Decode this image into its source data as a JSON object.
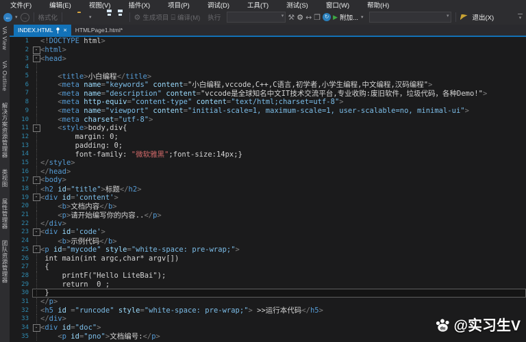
{
  "menu": {
    "items": [
      "文件(F)",
      "编辑(E)",
      "视图(V)",
      "插件(X)",
      "项目(P)",
      "调试(D)",
      "工具(T)",
      "测试(S)",
      "窗口(W)",
      "帮助(H)"
    ]
  },
  "toolbar": {
    "format_label": "格式化",
    "build_label": "生成项目",
    "compile_label": "编译(M)",
    "run_label": "执行",
    "attach_label": "附加...",
    "exit_label": "退出(X)"
  },
  "tabs": [
    {
      "label": "INDEX.HTML",
      "active": true
    },
    {
      "label": "HTMLPage1.html*",
      "active": false
    }
  ],
  "sidebar": {
    "items": [
      "VA View",
      "VA Outline",
      "解决方案资源管理器",
      "类视图",
      "属性管理器",
      "团队资源管理器"
    ]
  },
  "editor": {
    "current_line": 30,
    "lines": [
      {
        "n": 1,
        "fold": false,
        "tokens": [
          [
            "<!",
            "g"
          ],
          [
            "DOCTYPE",
            "t"
          ],
          [
            " html",
            "w"
          ],
          [
            ">",
            "g"
          ]
        ]
      },
      {
        "n": 2,
        "fold": true,
        "tokens": [
          [
            "<",
            "g"
          ],
          [
            "html",
            "t"
          ],
          [
            ">",
            "g"
          ]
        ]
      },
      {
        "n": 3,
        "fold": true,
        "tokens": [
          [
            "<",
            "g"
          ],
          [
            "head",
            "t"
          ],
          [
            ">",
            "g"
          ]
        ]
      },
      {
        "n": 4,
        "fold": false,
        "tokens": []
      },
      {
        "n": 5,
        "fold": false,
        "tokens": [
          [
            "    ",
            "w"
          ],
          [
            "<",
            "g"
          ],
          [
            "title",
            "t"
          ],
          [
            ">",
            "g"
          ],
          [
            "小白编程",
            "w"
          ],
          [
            "</",
            "g"
          ],
          [
            "title",
            "t"
          ],
          [
            ">",
            "g"
          ]
        ]
      },
      {
        "n": 6,
        "fold": false,
        "tokens": [
          [
            "    ",
            "w"
          ],
          [
            "<",
            "g"
          ],
          [
            "meta",
            "t"
          ],
          [
            " ",
            "w"
          ],
          [
            "name",
            "a"
          ],
          [
            "=",
            "g"
          ],
          [
            "\"keywords\"",
            "v"
          ],
          [
            " ",
            "w"
          ],
          [
            "content",
            "a"
          ],
          [
            "=",
            "g"
          ],
          [
            "\"小白编程,vccode,C++,C语言,初学者,小学生编程,中文编程,汉码编程\"",
            "w"
          ],
          [
            ">",
            "g"
          ]
        ]
      },
      {
        "n": 7,
        "fold": false,
        "tokens": [
          [
            "    ",
            "w"
          ],
          [
            "<",
            "g"
          ],
          [
            "meta",
            "t"
          ],
          [
            " ",
            "w"
          ],
          [
            "name",
            "a"
          ],
          [
            "=",
            "g"
          ],
          [
            "\"description\"",
            "v"
          ],
          [
            " ",
            "w"
          ],
          [
            "content",
            "a"
          ],
          [
            "=",
            "g"
          ],
          [
            "\"vccode是全球知名中文IT技术交流平台,专业收购:废旧软件，垃圾代码，各种Demo!\"",
            "w"
          ],
          [
            ">",
            "g"
          ]
        ]
      },
      {
        "n": 8,
        "fold": false,
        "tokens": [
          [
            "    ",
            "w"
          ],
          [
            "<",
            "g"
          ],
          [
            "meta",
            "t"
          ],
          [
            " ",
            "w"
          ],
          [
            "http-equiv",
            "a"
          ],
          [
            "=",
            "g"
          ],
          [
            "\"content-type\"",
            "v"
          ],
          [
            " ",
            "w"
          ],
          [
            "content",
            "a"
          ],
          [
            "=",
            "g"
          ],
          [
            "\"text/html;charset=utf-8\"",
            "v"
          ],
          [
            ">",
            "g"
          ]
        ]
      },
      {
        "n": 9,
        "fold": false,
        "tokens": [
          [
            "    ",
            "w"
          ],
          [
            "<",
            "g"
          ],
          [
            "meta",
            "t"
          ],
          [
            " ",
            "w"
          ],
          [
            "name",
            "a"
          ],
          [
            "=",
            "g"
          ],
          [
            "\"viewport\"",
            "v"
          ],
          [
            " ",
            "w"
          ],
          [
            "content",
            "a"
          ],
          [
            "=",
            "g"
          ],
          [
            "\"initial-scale=1, maximum-scale=1, user-scalable=no, minimal-ui\"",
            "v"
          ],
          [
            ">",
            "g"
          ]
        ]
      },
      {
        "n": 10,
        "fold": false,
        "tokens": [
          [
            "    ",
            "w"
          ],
          [
            "<",
            "g"
          ],
          [
            "meta",
            "t"
          ],
          [
            " ",
            "w"
          ],
          [
            "charset",
            "a"
          ],
          [
            "=",
            "g"
          ],
          [
            "\"utf-8\"",
            "v"
          ],
          [
            ">",
            "g"
          ]
        ]
      },
      {
        "n": 11,
        "fold": true,
        "tokens": [
          [
            "    ",
            "w"
          ],
          [
            "<",
            "g"
          ],
          [
            "style",
            "t"
          ],
          [
            ">",
            "g"
          ],
          [
            "body,div{",
            "w"
          ]
        ]
      },
      {
        "n": 12,
        "fold": false,
        "tokens": [
          [
            "        margin: 0;",
            "w"
          ]
        ]
      },
      {
        "n": 13,
        "fold": false,
        "tokens": [
          [
            "        padding: 0;",
            "w"
          ]
        ]
      },
      {
        "n": 14,
        "fold": false,
        "tokens": [
          [
            "        font-family: ",
            "w"
          ],
          [
            "\"微软雅黑\"",
            "s"
          ],
          [
            ";font-size:14px;}",
            "w"
          ]
        ]
      },
      {
        "n": 15,
        "fold": false,
        "tokens": [
          [
            "</",
            "g"
          ],
          [
            "style",
            "t"
          ],
          [
            ">",
            "g"
          ]
        ]
      },
      {
        "n": 16,
        "fold": false,
        "tokens": [
          [
            "</",
            "g"
          ],
          [
            "head",
            "t"
          ],
          [
            ">",
            "g"
          ]
        ]
      },
      {
        "n": 17,
        "fold": true,
        "tokens": [
          [
            "<",
            "g"
          ],
          [
            "body",
            "t"
          ],
          [
            ">",
            "g"
          ]
        ]
      },
      {
        "n": 18,
        "fold": false,
        "tokens": [
          [
            "<",
            "g"
          ],
          [
            "h2",
            "t"
          ],
          [
            " ",
            "w"
          ],
          [
            "id",
            "a"
          ],
          [
            "=",
            "g"
          ],
          [
            "\"title\"",
            "v"
          ],
          [
            ">",
            "g"
          ],
          [
            "标题",
            "w"
          ],
          [
            "</",
            "g"
          ],
          [
            "h2",
            "t"
          ],
          [
            ">",
            "g"
          ]
        ]
      },
      {
        "n": 19,
        "fold": true,
        "tokens": [
          [
            "<",
            "g"
          ],
          [
            "div",
            "t"
          ],
          [
            " ",
            "w"
          ],
          [
            "id",
            "a"
          ],
          [
            "=",
            "g"
          ],
          [
            "'content'",
            "v"
          ],
          [
            ">",
            "g"
          ]
        ]
      },
      {
        "n": 20,
        "fold": false,
        "tokens": [
          [
            "    ",
            "w"
          ],
          [
            "<",
            "g"
          ],
          [
            "b",
            "t"
          ],
          [
            ">",
            "g"
          ],
          [
            "文档内容",
            "w"
          ],
          [
            "</",
            "g"
          ],
          [
            "b",
            "t"
          ],
          [
            ">",
            "g"
          ]
        ]
      },
      {
        "n": 21,
        "fold": false,
        "tokens": [
          [
            "    ",
            "w"
          ],
          [
            "<",
            "g"
          ],
          [
            "p",
            "t"
          ],
          [
            ">",
            "g"
          ],
          [
            "请开始编写你的内容..",
            "w"
          ],
          [
            "</",
            "g"
          ],
          [
            "p",
            "t"
          ],
          [
            ">",
            "g"
          ]
        ]
      },
      {
        "n": 22,
        "fold": false,
        "tokens": [
          [
            "</",
            "g"
          ],
          [
            "div",
            "t"
          ],
          [
            ">",
            "g"
          ]
        ]
      },
      {
        "n": 23,
        "fold": true,
        "tokens": [
          [
            "<",
            "g"
          ],
          [
            "div",
            "t"
          ],
          [
            " ",
            "w"
          ],
          [
            "id",
            "a"
          ],
          [
            "=",
            "g"
          ],
          [
            "'code'",
            "v"
          ],
          [
            ">",
            "g"
          ]
        ]
      },
      {
        "n": 24,
        "fold": false,
        "tokens": [
          [
            "    ",
            "w"
          ],
          [
            "<",
            "g"
          ],
          [
            "b",
            "t"
          ],
          [
            ">",
            "g"
          ],
          [
            "示例代码",
            "w"
          ],
          [
            "</",
            "g"
          ],
          [
            "b",
            "t"
          ],
          [
            ">",
            "g"
          ]
        ]
      },
      {
        "n": 25,
        "fold": true,
        "tokens": [
          [
            "<",
            "g"
          ],
          [
            "p",
            "t"
          ],
          [
            " ",
            "w"
          ],
          [
            "id",
            "a"
          ],
          [
            "=",
            "g"
          ],
          [
            "\"mycode\"",
            "v"
          ],
          [
            " ",
            "w"
          ],
          [
            "style",
            "a"
          ],
          [
            "=",
            "g"
          ],
          [
            "\"white-space: pre-wrap;\"",
            "v"
          ],
          [
            ">",
            "g"
          ]
        ]
      },
      {
        "n": 26,
        "fold": false,
        "tokens": [
          [
            " int main(int argc,char* argv[])",
            "w"
          ]
        ]
      },
      {
        "n": 27,
        "fold": false,
        "tokens": [
          [
            " {",
            "w"
          ]
        ]
      },
      {
        "n": 28,
        "fold": false,
        "tokens": [
          [
            "     printF(\"Hello LiteBai\");",
            "w"
          ]
        ]
      },
      {
        "n": 29,
        "fold": false,
        "tokens": [
          [
            "     return  0 ;",
            "w"
          ]
        ]
      },
      {
        "n": 30,
        "fold": false,
        "tokens": [
          [
            " }",
            "w"
          ]
        ]
      },
      {
        "n": 31,
        "fold": false,
        "tokens": [
          [
            "</",
            "g"
          ],
          [
            "p",
            "t"
          ],
          [
            ">",
            "g"
          ]
        ]
      },
      {
        "n": 32,
        "fold": false,
        "tokens": [
          [
            "<",
            "g"
          ],
          [
            "h5",
            "t"
          ],
          [
            " ",
            "w"
          ],
          [
            "id",
            "a"
          ],
          [
            " =",
            "g"
          ],
          [
            "\"runcode\"",
            "v"
          ],
          [
            " ",
            "w"
          ],
          [
            "style",
            "a"
          ],
          [
            "=",
            "g"
          ],
          [
            "\"white-space: pre-wrap;\"",
            "v"
          ],
          [
            ">",
            "g"
          ],
          [
            " >>运行本代码",
            "w"
          ],
          [
            "</",
            "g"
          ],
          [
            "h5",
            "t"
          ],
          [
            ">",
            "g"
          ]
        ]
      },
      {
        "n": 33,
        "fold": false,
        "tokens": [
          [
            "</",
            "g"
          ],
          [
            "div",
            "t"
          ],
          [
            ">",
            "g"
          ]
        ]
      },
      {
        "n": 34,
        "fold": true,
        "tokens": [
          [
            "<",
            "g"
          ],
          [
            "div",
            "t"
          ],
          [
            " ",
            "w"
          ],
          [
            "id",
            "a"
          ],
          [
            "=",
            "g"
          ],
          [
            "\"doc\"",
            "v"
          ],
          [
            ">",
            "g"
          ]
        ]
      },
      {
        "n": 35,
        "fold": false,
        "tokens": [
          [
            "    ",
            "w"
          ],
          [
            "<",
            "g"
          ],
          [
            "p",
            "t"
          ],
          [
            " ",
            "w"
          ],
          [
            "id",
            "a"
          ],
          [
            "=",
            "g"
          ],
          [
            "\"pno\"",
            "v"
          ],
          [
            ">",
            "g"
          ],
          [
            "文档编号:",
            "w"
          ],
          [
            "</",
            "g"
          ],
          [
            "p",
            "t"
          ],
          [
            ">",
            "g"
          ]
        ]
      }
    ]
  },
  "watermark": {
    "handle": "@实习生V",
    "icon": "baidu-paw-icon"
  },
  "colors": {
    "accent_blue": "#1272b8",
    "tag": "#569cd6",
    "attr": "#9cdcfe",
    "string_red": "#d16969",
    "line_number": "#2f8bb0"
  }
}
